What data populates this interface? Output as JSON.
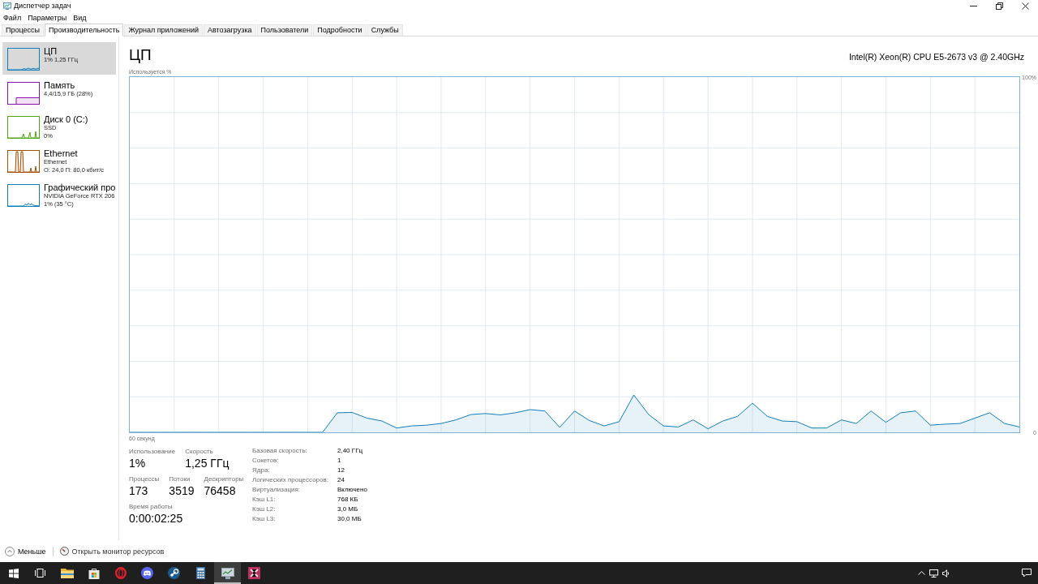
{
  "window": {
    "title": "Диспетчер задач"
  },
  "menu": [
    "Файл",
    "Параметры",
    "Вид"
  ],
  "tabs": [
    {
      "label": "Процессы",
      "selected": false
    },
    {
      "label": "Производительность",
      "selected": true
    },
    {
      "label": "Журнал приложений",
      "selected": false
    },
    {
      "label": "Автозагрузка",
      "selected": false
    },
    {
      "label": "Пользователи",
      "selected": false
    },
    {
      "label": "Подробности",
      "selected": false
    },
    {
      "label": "Службы",
      "selected": false
    }
  ],
  "sidebar": {
    "items": [
      {
        "kind": "cpu",
        "title": "ЦП",
        "lines": [
          "1% 1,25 ГГц"
        ],
        "selected": true,
        "color": "#117dbb"
      },
      {
        "kind": "memory",
        "title": "Память",
        "lines": [
          "4,4/15,9 ГБ (28%)"
        ],
        "selected": false,
        "color": "#8b12ae"
      },
      {
        "kind": "disk",
        "title": "Диск 0 (C:)",
        "lines": [
          "SSD",
          "0%"
        ],
        "selected": false,
        "color": "#4da60c"
      },
      {
        "kind": "network",
        "title": "Ethernet",
        "lines": [
          "Ethernet",
          "О: 24,0 П: 80,0 кбит/с"
        ],
        "selected": false,
        "color": "#a74f01"
      },
      {
        "kind": "gpu",
        "title": "Графический про",
        "lines": [
          "NVIDIA GeForce RTX 206",
          "1% (35 °C)"
        ],
        "selected": false,
        "color": "#117dbb"
      }
    ]
  },
  "main": {
    "title": "ЦП",
    "device": "Intel(R) Xeon(R) CPU E5-2673 v3 @ 2.40GHz",
    "chart_data": {
      "type": "area",
      "ylabel": "Используется %",
      "xlabel": "60 секунд",
      "categories": [
        null,
        null,
        null,
        null,
        null,
        null,
        null,
        null,
        null,
        null,
        null,
        null,
        null,
        null,
        null,
        null,
        null,
        null,
        null,
        null,
        null,
        null,
        null,
        null,
        null,
        null,
        null,
        null,
        null,
        null,
        null,
        null,
        null,
        null,
        null,
        null,
        null,
        null,
        null,
        null,
        null,
        null,
        null,
        null,
        null,
        null,
        null,
        null,
        null,
        null,
        null,
        null,
        null,
        null,
        null,
        null,
        null,
        null,
        null,
        null,
        null
      ],
      "ylim": [
        0,
        100
      ],
      "yticks": [
        {
          "value": 100,
          "label": "100%"
        },
        {
          "value": 0,
          "label": "0"
        }
      ],
      "grid": true,
      "series": [
        {
          "color": "#117dbb",
          "values": [
            0,
            0,
            0,
            0,
            0,
            0,
            0,
            0,
            0,
            0,
            0,
            0,
            0,
            0,
            5.5,
            5.6,
            4.0,
            3.2,
            1.2,
            1.8,
            2.0,
            2.5,
            3.5,
            5.0,
            5.3,
            4.9,
            5.5,
            6.4,
            6.0,
            1.4,
            6.0,
            3.3,
            1.8,
            3.0,
            10.5,
            5.0,
            1.8,
            1.5,
            3.5,
            1.0,
            3.2,
            4.5,
            8.2,
            4.5,
            3.2,
            3.0,
            1.2,
            1.2,
            3.5,
            2.5,
            6.0,
            2.8,
            5.5,
            6.0,
            2.0,
            2.3,
            2.5,
            4.0,
            5.5,
            2.5,
            1.5
          ]
        }
      ]
    },
    "stats": [
      [
        {
          "label": "Использование",
          "value": "1%"
        },
        {
          "label": "Скорость",
          "value": "1,25 ГГц"
        }
      ],
      [
        {
          "label": "Процессы",
          "value": "173"
        },
        {
          "label": "Потоки",
          "value": "3519"
        },
        {
          "label": "Дескрипторы",
          "value": "76458"
        }
      ],
      [
        {
          "label": "Время работы",
          "value": "0:00:02:25"
        }
      ]
    ],
    "details": [
      {
        "label": "Базовая скорость:",
        "value": "2,40 ГГц"
      },
      {
        "label": "Сокетов:",
        "value": "1"
      },
      {
        "label": "Ядра:",
        "value": "12"
      },
      {
        "label": "Логических процессоров:",
        "value": "24"
      },
      {
        "label": "Виртуализация:",
        "value": "Включено"
      },
      {
        "label": "Кэш L1:",
        "value": "768 КБ"
      },
      {
        "label": "Кэш L2:",
        "value": "3,0 МБ"
      },
      {
        "label": "Кэш L3:",
        "value": "30,0 МБ"
      }
    ]
  },
  "footer": {
    "less": "Меньше",
    "link": "Открыть монитор ресурсов"
  },
  "taskbar": {
    "buttons": [
      {
        "kind": "start",
        "selected": false
      },
      {
        "kind": "taskview",
        "selected": false
      },
      {
        "kind": "folder",
        "selected": false
      },
      {
        "kind": "store",
        "selected": false
      },
      {
        "kind": "browser",
        "selected": false
      },
      {
        "kind": "chat",
        "selected": false
      },
      {
        "kind": "games",
        "selected": false
      },
      {
        "kind": "calculator",
        "selected": false
      },
      {
        "kind": "monitor",
        "selected": true
      },
      {
        "kind": "app",
        "selected": false
      }
    ]
  }
}
